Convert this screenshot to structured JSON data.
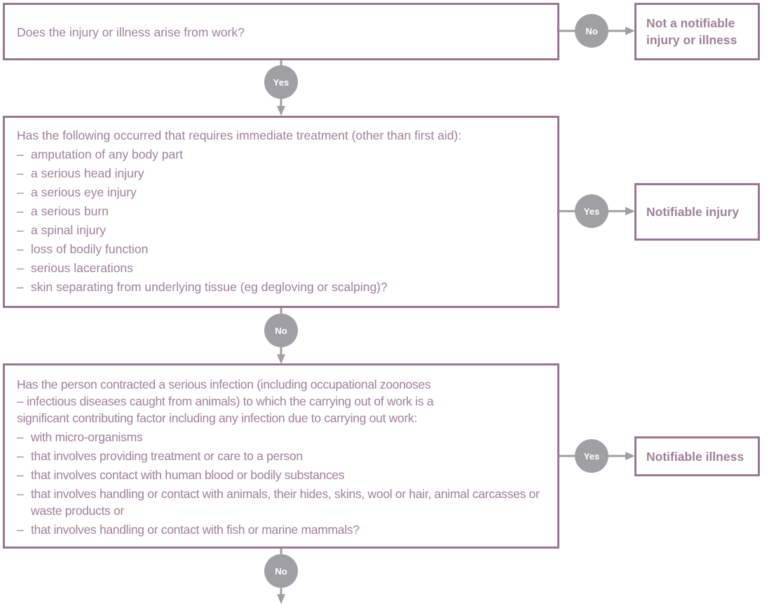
{
  "colors": {
    "box_border": "#987790",
    "text": "#9e8198",
    "connector": "#a0a0a4",
    "connector_label": "#ffffff"
  },
  "questions": [
    {
      "id": "q1",
      "lines": [
        "Does the injury or illness arise from work?"
      ],
      "items": []
    },
    {
      "id": "q2",
      "lines": [
        "Has the following occurred that requires immediate treatment (other than first aid):"
      ],
      "items": [
        "amputation of any body part",
        "a serious head injury",
        "a serious eye injury",
        "a serious burn",
        "a spinal injury",
        "loss of bodily function",
        "serious lacerations",
        "skin separating from underlying tissue (eg degloving or scalping)?"
      ]
    },
    {
      "id": "q3",
      "lines": [
        "Has the person contracted a serious infection (including occupational zoonoses",
        "– infectious diseases caught from animals) to which the carrying out of work is a",
        "significant contributing factor including any infection due to carrying out work:"
      ],
      "items": [
        "with micro-organisms",
        "that involves providing treatment or care to a person",
        "that involves contact with human blood or bodily substances",
        "that involves handling or contact with animals, their hides, skins, wool or hair, animal carcasses or waste products or",
        "that involves handling or contact with fish or marine mammals?"
      ]
    }
  ],
  "outcomes": {
    "not_notifiable": "Not a notifiable injury or illness",
    "notifiable_injury": "Notifiable injury",
    "notifiable_illness": "Notifiable illness"
  },
  "connectors": {
    "q1_side": "No",
    "q1_down": "Yes",
    "q2_side": "Yes",
    "q2_down": "No",
    "q3_side": "Yes",
    "q3_down": "No"
  },
  "bullet": "–"
}
